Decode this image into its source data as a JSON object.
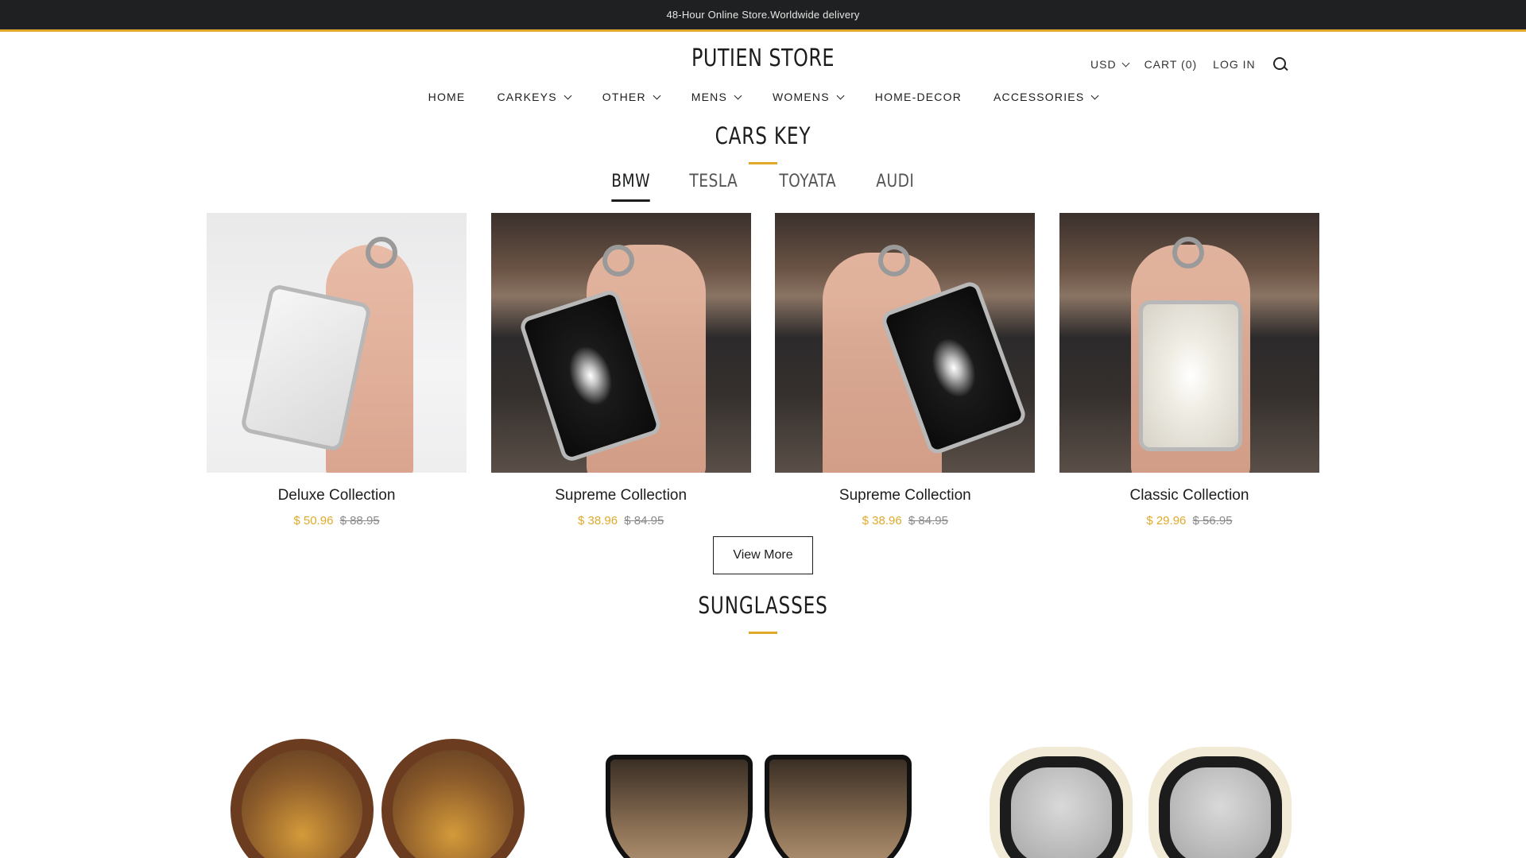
{
  "announcement": "48-Hour Online Store.Worldwide delivery",
  "store_name": "PUTIEN STORE",
  "utility": {
    "currency": "USD",
    "cart": "CART (0)",
    "login": "LOG IN"
  },
  "nav": [
    {
      "label": "HOME",
      "dropdown": false
    },
    {
      "label": "CARKEYS",
      "dropdown": true
    },
    {
      "label": "OTHER",
      "dropdown": true
    },
    {
      "label": "MENS",
      "dropdown": true
    },
    {
      "label": "WOMENS",
      "dropdown": true
    },
    {
      "label": "HOME-DECOR",
      "dropdown": false
    },
    {
      "label": "ACCESSORIES",
      "dropdown": true
    }
  ],
  "cars_key": {
    "title": "CARS KEY",
    "tabs": [
      "BMW",
      "TESLA",
      "TOYATA",
      "AUDI"
    ],
    "active_tab": "BMW",
    "products": [
      {
        "name": "Deluxe Collection",
        "sale_price": "$ 50.96",
        "orig_price": "$ 88.95"
      },
      {
        "name": "Supreme Collection",
        "sale_price": "$ 38.96",
        "orig_price": "$ 84.95"
      },
      {
        "name": "Supreme Collection",
        "sale_price": "$ 38.96",
        "orig_price": "$ 84.95"
      },
      {
        "name": "Classic Collection",
        "sale_price": "$ 29.96",
        "orig_price": "$ 56.95"
      }
    ],
    "view_more": "View More"
  },
  "sunglasses": {
    "title": "SUNGLASSES"
  },
  "colors": {
    "accent": "#e0a92b",
    "announcement_bg": "#1f2021",
    "text": "#1c1d1d"
  }
}
